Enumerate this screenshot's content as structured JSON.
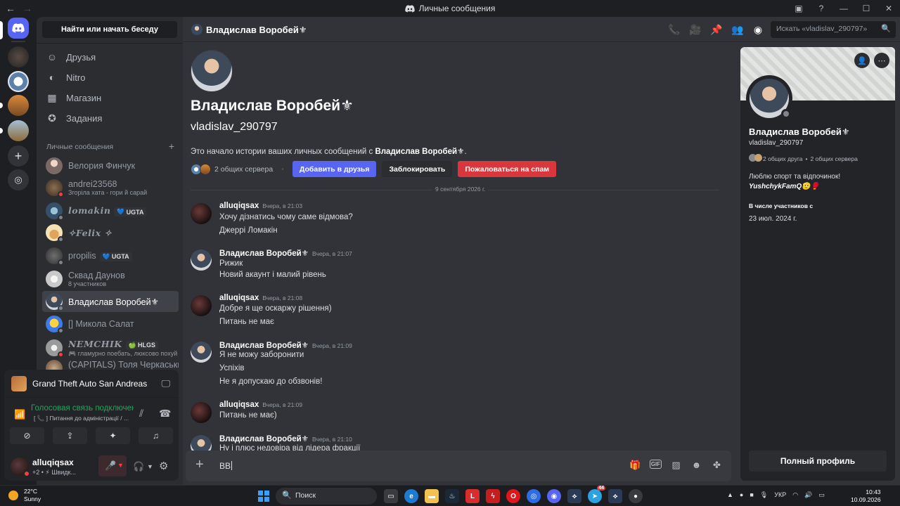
{
  "window": {
    "title": "Личные сообщения"
  },
  "sidebar": {
    "search_label": "Найти или начать беседу",
    "nav": [
      {
        "label": "Друзья",
        "icon": "friends-icon"
      },
      {
        "label": "Nitro",
        "icon": "nitro-icon"
      },
      {
        "label": "Магазин",
        "icon": "shop-icon"
      },
      {
        "label": "Задания",
        "icon": "quests-icon"
      }
    ],
    "dm_header": "Личные сообщения",
    "dms": [
      {
        "name": "Велория Финчук",
        "sub": "",
        "status": "none"
      },
      {
        "name": "andrei23568",
        "sub": "Згоріла хата - гори й сарай",
        "status": "dnd"
      },
      {
        "name": "lomakin",
        "tag": "UGTA",
        "status": "offline"
      },
      {
        "name": "✧Felix ✧",
        "status": "offline"
      },
      {
        "name": "propilis",
        "tag": "UGTA",
        "status": "offline"
      },
      {
        "name": "Сквад Даунов",
        "sub": "8 участников",
        "status": "none"
      },
      {
        "name": "Владислав Воробей⚜",
        "status": "offline",
        "active": true
      },
      {
        "name": "[] Микола Салат",
        "status": "offline"
      },
      {
        "name": "NEMCHIK",
        "tag": "HLGS",
        "sub": "гламурно поебать, люксово похуй",
        "status": "dnd"
      },
      {
        "name": "(CAPITALS) Толя Черкаський",
        "status": "none"
      }
    ]
  },
  "panel": {
    "game": "Grand Theft Auto San Andreas",
    "voice_title": "Голосовая связь подключена",
    "voice_sub": "[ 📞 ] Питання до адміністрації / ...",
    "user_name": "alluqiqsax",
    "user_status": "+2 • ⚡ Швидк..."
  },
  "header": {
    "name": "Владислав Воробей⚜",
    "search_placeholder": "Искать «vladislav_290797»"
  },
  "intro": {
    "name": "Владислав Воробей⚜",
    "username": "vladislav_290797",
    "text_prefix": "Это начало истории ваших личных сообщений с ",
    "text_name": "Владислав Воробей⚜",
    "text_suffix": ".",
    "mutual_servers": "2 общих сервера",
    "add_friend": "Добавить в друзья",
    "block": "Заблокировать",
    "report": "Пожаловаться на спам"
  },
  "date_separator": "9 сентября 2026 г.",
  "messages": [
    {
      "author": "alluqiqsax",
      "time": "Вчера, в 21:03",
      "lines": [
        "Хочу дізнатись чому саме відмова?",
        "Джеррі Ломакін"
      ]
    },
    {
      "author": "Владислав Воробей⚜",
      "time": "Вчера, в 21:07",
      "lines": [
        "Рижик",
        "Новий акаунт і малий рівень"
      ]
    },
    {
      "author": "alluqiqsax",
      "time": "Вчера, в 21:08",
      "lines": [
        "Добре я ще оскаржу рішення)",
        "Питань не має"
      ]
    },
    {
      "author": "Владислав Воробей⚜",
      "time": "Вчера, в 21:09",
      "lines": [
        "Я не можу заборонити",
        "Успіхів",
        "Не я допускаю до обзвонів!"
      ]
    },
    {
      "author": "alluqiqsax",
      "time": "Вчера, в 21:09",
      "lines": [
        "Питань не має)"
      ]
    },
    {
      "author": "Владислав Воробей⚜",
      "time": "Вчера, в 21:10",
      "lines": [
        "Ну і плюс недовіра від лідера фракції"
      ]
    }
  ],
  "composer": {
    "value": "ВВ"
  },
  "profile": {
    "name": "Владислав Воробей⚜",
    "username": "vladislav_290797",
    "mutual_friends": "2 общих друга",
    "mutual_servers": "2 общих сервера",
    "bio_line1": "Люблю спорт та відпочинок!",
    "bio_line2": "YushchykFamQ🫡🥊",
    "member_label": "В числе участников с",
    "member_date": "23 июл. 2024 г.",
    "full_profile": "Полный профиль"
  },
  "taskbar": {
    "temperature": "22°C",
    "weather": "Sunny",
    "search": "Поиск",
    "lang": "УКР",
    "time": "10:43",
    "date": "10.09.2026",
    "badge": "44"
  }
}
